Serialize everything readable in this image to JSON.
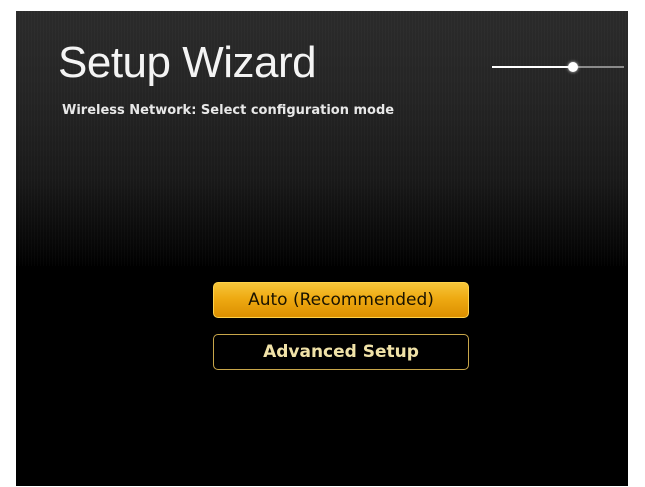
{
  "wizard": {
    "title": "Setup Wizard",
    "subtitle": "Wireless Network: Select configuration mode"
  },
  "progress": {
    "fraction": 0.61
  },
  "menu": {
    "options": [
      {
        "label": "Auto (Recommended)",
        "selected": true
      },
      {
        "label": "Advanced Setup",
        "selected": false
      }
    ]
  },
  "colors": {
    "accent": "#eeaa12",
    "button_border": "#c8a64a",
    "background": "#000000"
  }
}
